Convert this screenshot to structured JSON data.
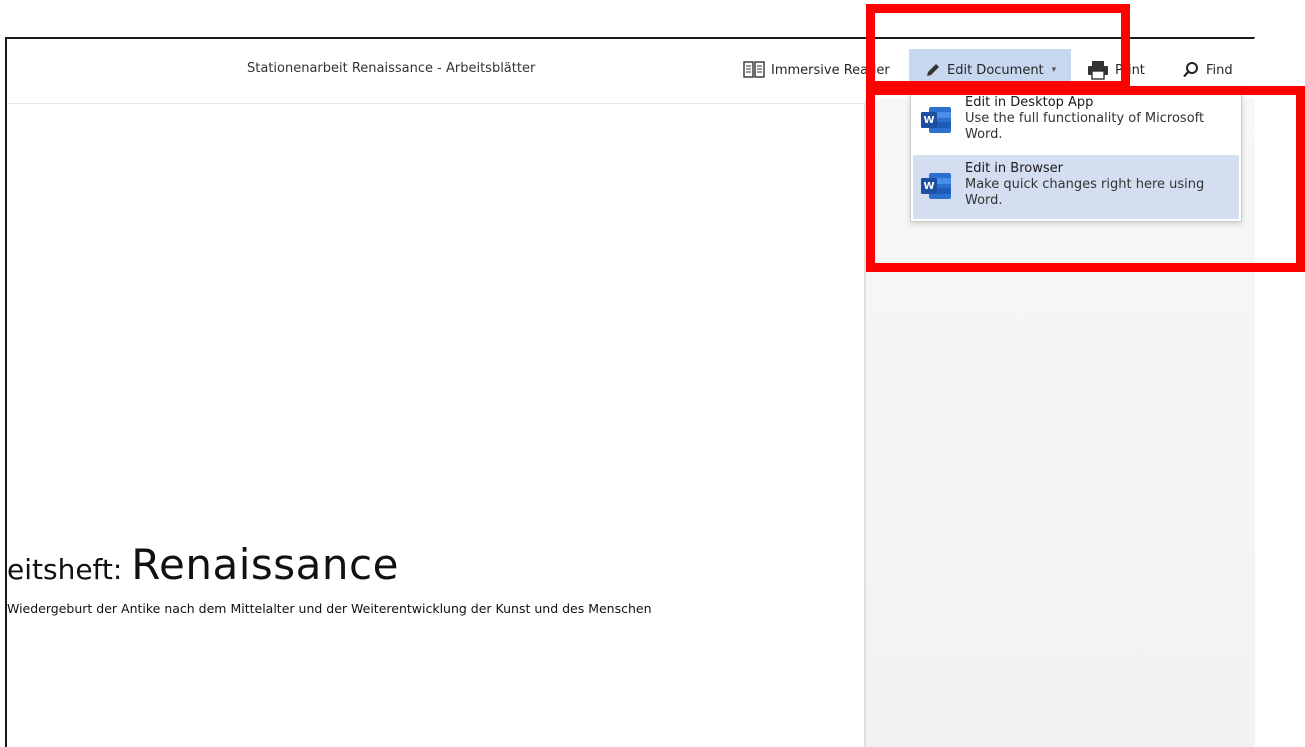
{
  "toolbar": {
    "document_title": "Stationenarbeit Renaissance - Arbeitsblätter",
    "immersive_reader_label": "Immersive Reader",
    "edit_document_label": "Edit Document",
    "print_label": "Print",
    "find_label": "Find"
  },
  "edit_menu": {
    "items": [
      {
        "title": "Edit in Desktop App",
        "description": "Use the full functionality of Microsoft Word.",
        "icon": "word-icon"
      },
      {
        "title": "Edit in Browser",
        "description": "Make quick changes right here using Word.",
        "icon": "word-icon",
        "highlighted": true
      }
    ]
  },
  "document": {
    "heading_prefix": "eitsheft: ",
    "heading_main": "Renaissance",
    "subtitle": "Wiedergeburt der Antike nach dem Mittelalter und der Weiterentwicklung der Kunst und des Menschen"
  },
  "colors": {
    "edit_button_bg": "#c7d7ef",
    "menu_hover_bg": "#d3def0",
    "highlight": "#ff0000",
    "word_blue": "#2b6fd0"
  }
}
